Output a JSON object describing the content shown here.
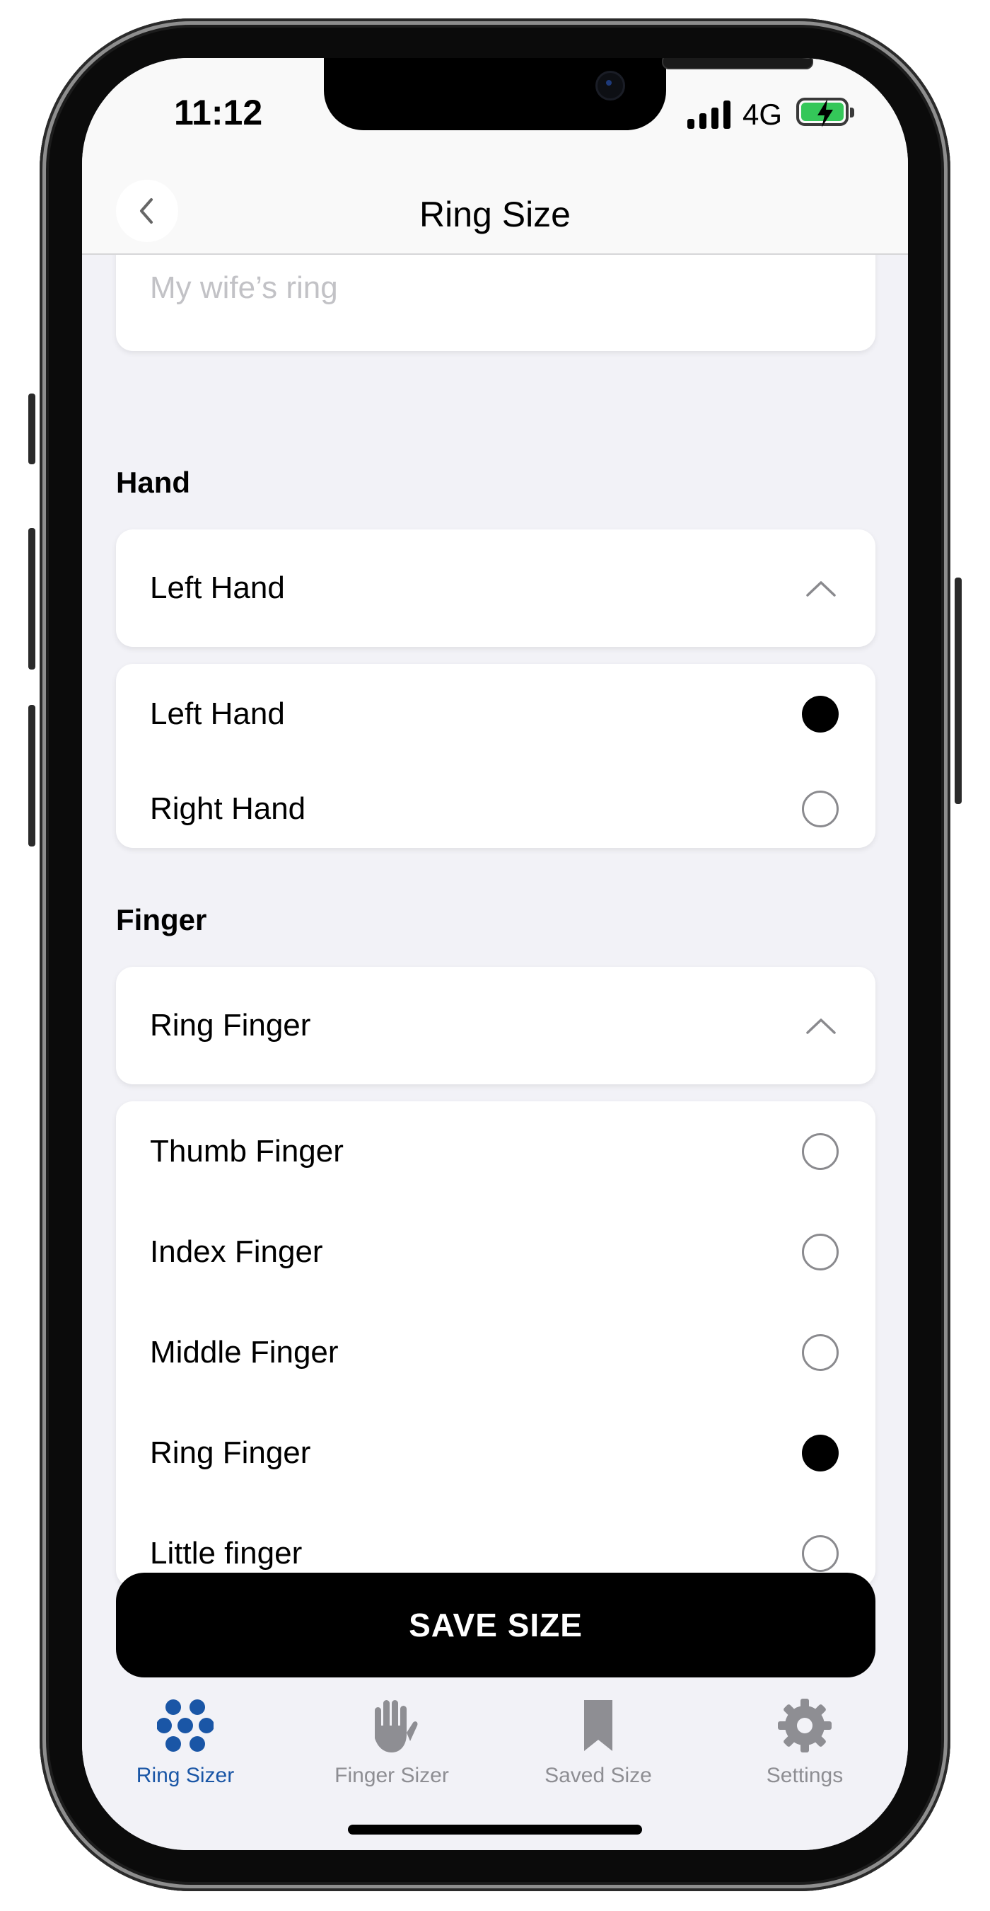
{
  "status": {
    "time": "11:12",
    "network": "4G"
  },
  "nav": {
    "title": "Ring Size"
  },
  "name_field": {
    "placeholder": "My wife’s ring"
  },
  "hand": {
    "section_title": "Hand",
    "selected": "Left Hand",
    "options": [
      {
        "label": "Left Hand",
        "checked": true
      },
      {
        "label": "Right Hand",
        "checked": false
      }
    ]
  },
  "finger": {
    "section_title": "Finger",
    "selected": "Ring Finger",
    "options": [
      {
        "label": "Thumb Finger",
        "checked": false
      },
      {
        "label": "Index Finger",
        "checked": false
      },
      {
        "label": "Middle Finger",
        "checked": false
      },
      {
        "label": "Ring Finger",
        "checked": true
      },
      {
        "label": "Little finger",
        "checked": false
      }
    ]
  },
  "save_button": "SAVE SIZE",
  "tabs": [
    {
      "label": "Ring Sizer",
      "icon": "ring-sizer-icon",
      "active": true
    },
    {
      "label": "Finger Sizer",
      "icon": "hand-icon",
      "active": false
    },
    {
      "label": "Saved Size",
      "icon": "bookmark-icon",
      "active": false
    },
    {
      "label": "Settings",
      "icon": "gear-icon",
      "active": false
    }
  ],
  "colors": {
    "accent": "#1a56a6",
    "inactive": "#8e8e93",
    "battery": "#34c759"
  }
}
